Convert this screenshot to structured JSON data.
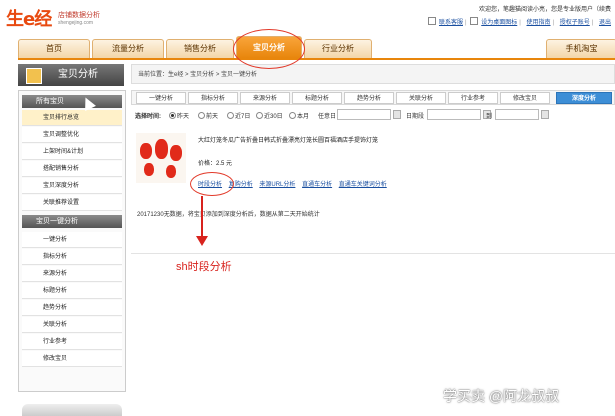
{
  "header": {
    "logo_text": "生e经",
    "logo_subtitle": "店铺数据分析",
    "logo_url": "shengejing.com",
    "welcome": "欢迎您，笔趣猫阅读小亮，您是专业版用户（续费",
    "links": [
      "联系客服",
      "设为桌面图标",
      "使用指南",
      "授权子账号",
      "退出"
    ]
  },
  "nav": {
    "tabs": [
      {
        "label": "首页",
        "active": false
      },
      {
        "label": "流量分析",
        "active": false
      },
      {
        "label": "销售分析",
        "active": false
      },
      {
        "label": "宝贝分析",
        "active": true
      },
      {
        "label": "行业分析",
        "active": false
      },
      {
        "label": "手机淘宝",
        "active": false
      }
    ]
  },
  "sidebar": {
    "title": "宝贝分析",
    "sections": [
      {
        "title": "所有宝贝",
        "items": [
          "宝贝排行总览",
          "宝贝调整优化",
          "上架时间&计划",
          "搭配销售分析",
          "宝贝深度分析",
          "关联推荐设置"
        ]
      },
      {
        "title": "宝贝一键分析",
        "items": [
          "一键分析",
          "指标分析",
          "来源分析",
          "标题分析",
          "趋势分析",
          "关联分析",
          "行业参考",
          "修改宝贝"
        ]
      }
    ],
    "active_item": "宝贝排行总览"
  },
  "breadcrumb": "当前位置：生e经 > 宝贝分析 > 宝贝一键分析",
  "subtabs": [
    "一键分析",
    "指标分析",
    "来源分析",
    "标题分析",
    "趋势分析",
    "关联分析",
    "行业参考",
    "修改宝贝",
    "深度分析"
  ],
  "active_subtab": "深度分析",
  "filters": {
    "label": "选择时间:",
    "options": [
      "昨天",
      "前天",
      "近7日",
      "近30日",
      "本月",
      "任意日"
    ],
    "selected": "昨天",
    "date_range_label": "日期段",
    "to_label": "到"
  },
  "product": {
    "title": "大红灯笼冬瓜广告折叠日韩式折叠漂亮灯笼长圆百福酒店手提饰灯笼",
    "price_label": "价格：",
    "price_value": "2.5 元",
    "links": [
      "时段分析",
      "复购分析",
      "来源URL分析",
      "直通车分析",
      "直通车关键词分析"
    ]
  },
  "note": "20171230无数据，将宝贝添加到深度分析后，数据从第二天开始统计",
  "annotation": "sh时段分析",
  "watermark": "学买卖 @阿龙叔叔",
  "colors": {
    "brand_orange": "#e8860c",
    "tab_blue": "#3d8ed6",
    "annotation_red": "#d8231e"
  }
}
